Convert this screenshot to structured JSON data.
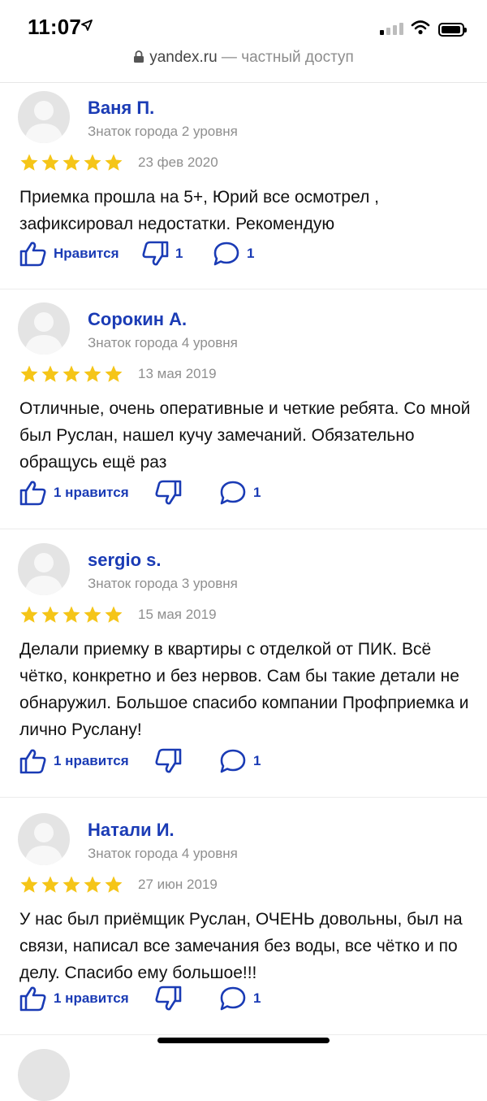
{
  "status": {
    "time": "11:07"
  },
  "url": {
    "host": "yandex.ru",
    "privacy": " — частный доступ"
  },
  "reviews": [
    {
      "name": "Ваня П.",
      "rank": "Знаток города 2 уровня",
      "rating": 5,
      "date": "23 фев 2020",
      "text": "Приемка прошла на 5+, Юрий все осмотрел , зафиксировал недостатки. Рекомендую",
      "like_label": "Нравится",
      "dislike_count": "1",
      "comment_count": "1"
    },
    {
      "name": "Сорокин А.",
      "rank": "Знаток города 4 уровня",
      "rating": 5,
      "date": "13 мая 2019",
      "text": "Отличные, очень оперативные и четкие ребята. Со мной был Руслан, нашел кучу замечаний. Обязательно обращусь ещё раз",
      "like_label": "1 нравится",
      "dislike_count": "",
      "comment_count": "1"
    },
    {
      "name": "sergio s.",
      "rank": "Знаток города 3 уровня",
      "rating": 5,
      "date": "15 мая 2019",
      "text": "Делали приемку в квартиры с отделкой от ПИК. Всё чётко, конкретно и без нервов. Сам бы такие детали не обнаружил. Большое спасибо компании Профприемка и лично Руслану!",
      "like_label": "1 нравится",
      "dislike_count": "",
      "comment_count": "1"
    },
    {
      "name": "Натали И.",
      "rank": "Знаток города 4 уровня",
      "rating": 5,
      "date": "27 июн 2019",
      "text": "У нас был приёмщик Руслан, ОЧЕНЬ довольны, был на связи, написал все замечания без воды, все чётко и по делу. Спасибо ему большое!!!",
      "like_label": "1 нравится",
      "dislike_count": "",
      "comment_count": "1"
    }
  ],
  "colors": {
    "accent": "#1a3bb5",
    "star": "#f5c518",
    "muted": "#8f8f8f"
  },
  "icons": [
    "location-arrow-icon",
    "signal-icon",
    "wifi-icon",
    "battery-icon",
    "lock-icon",
    "thumb-up-icon",
    "thumb-down-icon",
    "comment-icon",
    "star-icon",
    "avatar-placeholder-icon"
  ]
}
